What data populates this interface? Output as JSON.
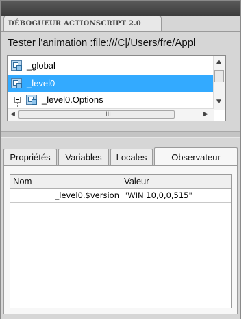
{
  "panel": {
    "title": "DÉBOGUEUR ACTIONSCRIPT 2.0",
    "path_label": "Tester l'animation :file:///C|/Users/fre/Appl"
  },
  "tree": {
    "items": [
      {
        "label": "_global",
        "selected": false,
        "icon": "movieclip-icon"
      },
      {
        "label": "_level0",
        "selected": true,
        "icon": "movieclip-icon"
      },
      {
        "label": "_level0.Options",
        "selected": false,
        "icon": "movieclip-icon",
        "expanded": true
      }
    ],
    "hscroll_grip": "III"
  },
  "tabs": [
    {
      "label": "Propriétés",
      "active": false
    },
    {
      "label": "Variables",
      "active": false
    },
    {
      "label": "Locales",
      "active": false
    },
    {
      "label": "Observateur",
      "active": true
    }
  ],
  "watch_table": {
    "columns": [
      "Nom",
      "Valeur"
    ],
    "rows": [
      {
        "name": "_level0.$version",
        "value": "\"WIN 10,0,0,515\""
      }
    ]
  },
  "colors": {
    "selection": "#33aaff",
    "panel_bg": "#d6d6d6",
    "title_strip": "#3c3c3c"
  }
}
